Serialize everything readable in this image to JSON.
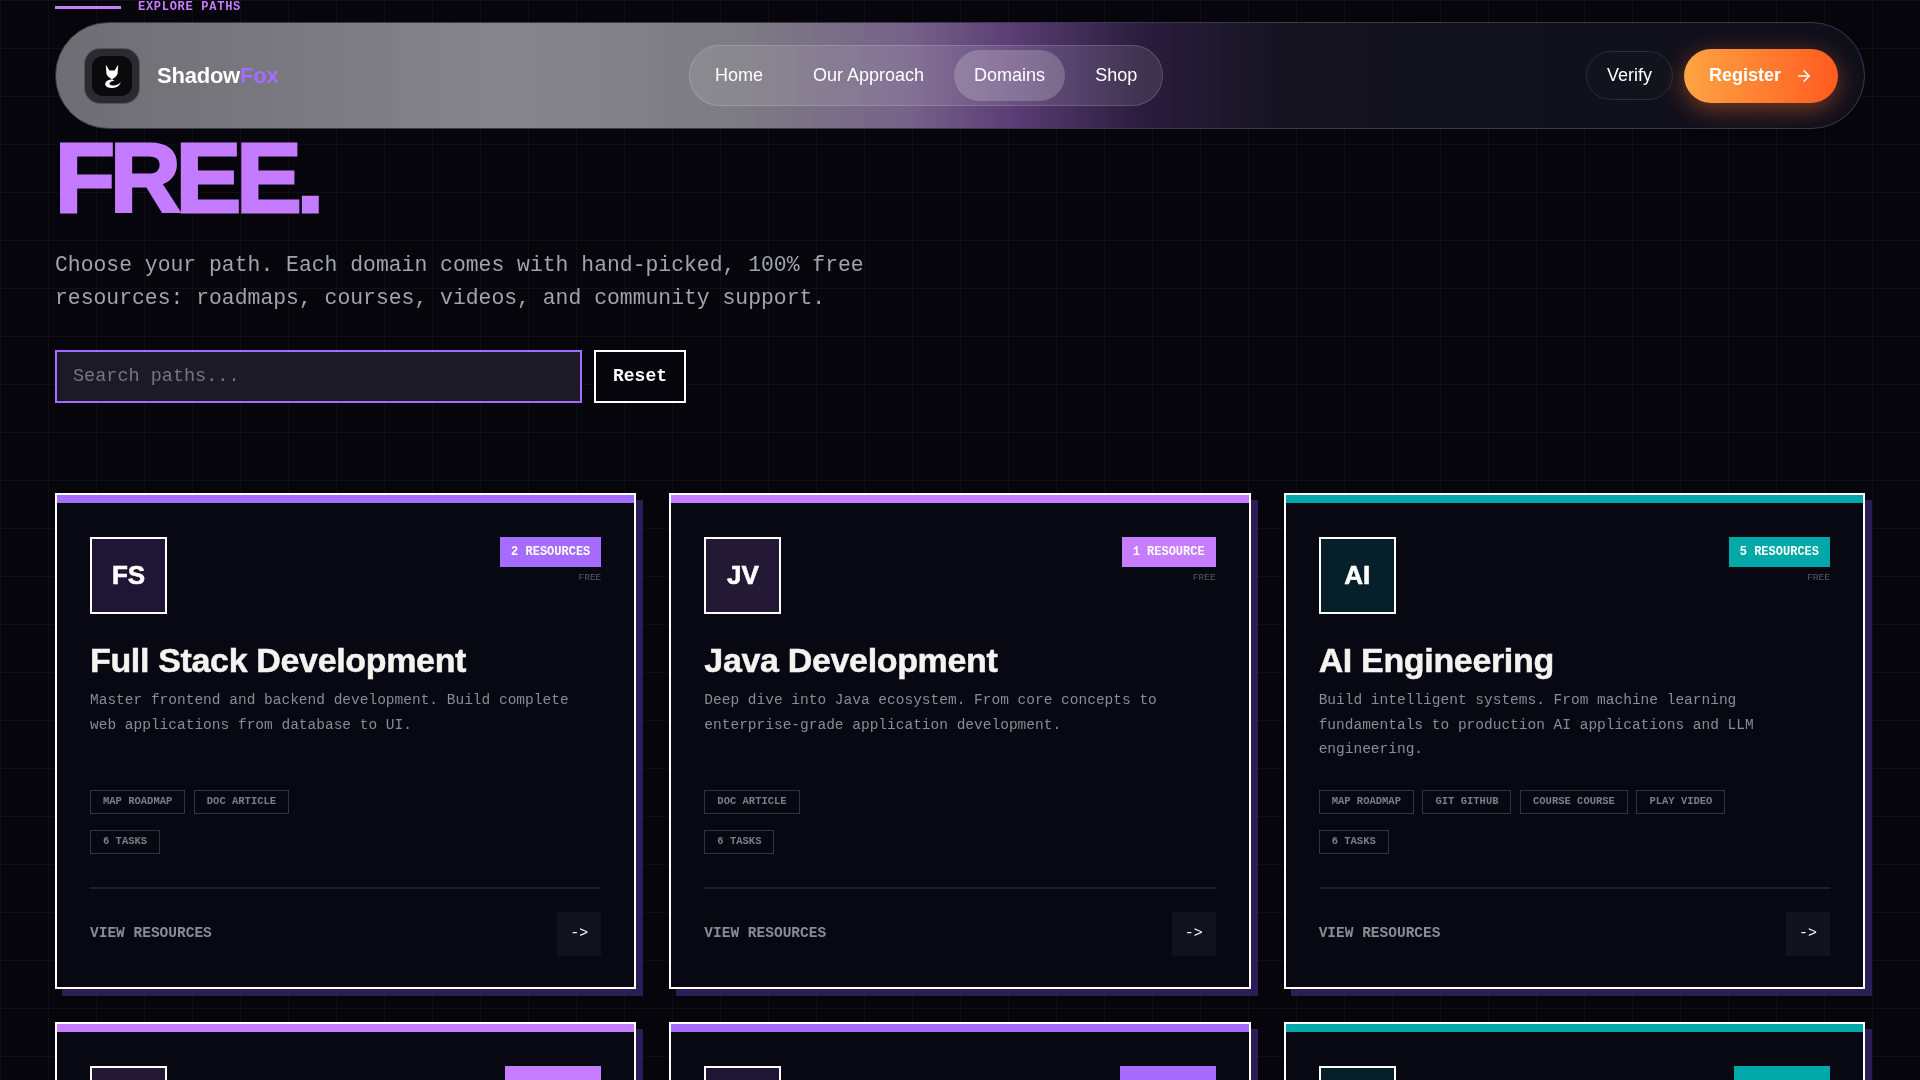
{
  "section_label": "EXPLORE PATHS",
  "nav": {
    "brand": {
      "name": "Shadow",
      "accent": "Fox"
    },
    "links": [
      {
        "label": "Home",
        "selected": false
      },
      {
        "label": "Our Approach",
        "selected": false
      },
      {
        "label": "Domains",
        "selected": true
      },
      {
        "label": "Shop",
        "selected": false
      }
    ],
    "actions": [
      {
        "label": "Verify",
        "kind": "secondary"
      },
      {
        "label": "Register",
        "kind": "primary"
      }
    ]
  },
  "hero": {
    "title": "FREE.",
    "subtitle": "Choose your path. Each domain comes with hand-picked, 100% free resources: roadmaps, courses, videos, and community support."
  },
  "search": {
    "placeholder": "Search paths...",
    "reset": "Reset"
  },
  "cards": [
    {
      "color": "#a66cff",
      "initials": "FS",
      "badge": "2 RESOURCES",
      "price": "FREE",
      "title": "Full Stack Development",
      "description": "Master frontend and backend development. Build complete web applications from database to UI.",
      "tags": [
        "MAP ROADMAP",
        "DOC ARTICLE"
      ],
      "tasks": "6 TASKS",
      "footer": "VIEW RESOURCES",
      "action": "->"
    },
    {
      "color": "#c77dff",
      "initials": "JV",
      "badge": "1 RESOURCE",
      "price": "FREE",
      "title": "Java Development",
      "description": "Deep dive into Java ecosystem. From core concepts to enterprise-grade application development.",
      "tags": [
        "DOC ARTICLE"
      ],
      "tasks": "6 TASKS",
      "footer": "VIEW RESOURCES",
      "action": "->"
    },
    {
      "color": "#00a8a8",
      "initials": "AI",
      "badge": "5 RESOURCES",
      "price": "FREE",
      "title": "AI Engineering",
      "description": "Build intelligent systems. From machine learning fundamentals to production AI applications and LLM engineering.",
      "tags": [
        "MAP ROADMAP",
        "GIT GITHUB",
        "COURSE COURSE",
        "PLAY VIDEO"
      ],
      "tasks": "6 TASKS",
      "footer": "VIEW RESOURCES",
      "action": "->"
    },
    {
      "color": "#c77dff"
    },
    {
      "color": "#a66cff"
    },
    {
      "color": "#00a8a8"
    }
  ]
}
